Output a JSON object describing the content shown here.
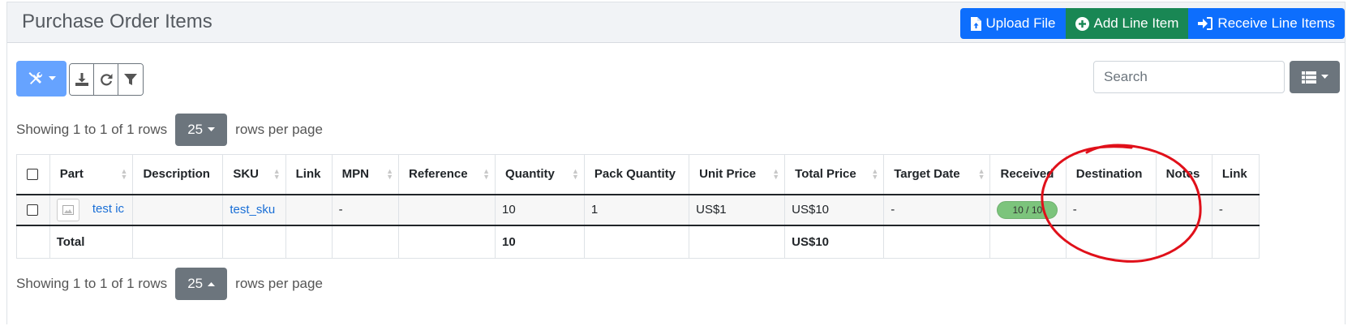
{
  "header": {
    "title": "Purchase Order Items",
    "upload_label": "Upload File",
    "add_label": "Add Line Item",
    "receive_label": "Receive Line Items",
    "colors": {
      "blue": "#0d6efd",
      "green": "#198754"
    }
  },
  "toolbar": {
    "search_placeholder": "Search",
    "icons": [
      "tools-icon",
      "download-icon",
      "refresh-icon",
      "filter-icon",
      "list-view-icon"
    ]
  },
  "pagination": {
    "top_text": "Showing 1 to 1 of 1 rows",
    "bottom_text": "Showing 1 to 1 of 1 rows",
    "page_size": "25",
    "rows_per_page_label": "rows per page"
  },
  "table": {
    "columns": [
      "Part",
      "Description",
      "SKU",
      "Link",
      "MPN",
      "Reference",
      "Quantity",
      "Pack Quantity",
      "Unit Price",
      "Total Price",
      "Target Date",
      "Received",
      "Destination",
      "Notes",
      "Link"
    ],
    "row": {
      "part": "test ic",
      "description": "",
      "sku": "test_sku",
      "link": "",
      "mpn": "-",
      "reference": "",
      "quantity": "10",
      "pack_quantity": "1",
      "unit_price": "US$1",
      "total_price": "US$10",
      "target_date": "-",
      "received": "10 / 10",
      "destination": "-",
      "notes": "",
      "link2": "-"
    },
    "total": {
      "label": "Total",
      "quantity": "10",
      "total_price": "US$10"
    }
  }
}
